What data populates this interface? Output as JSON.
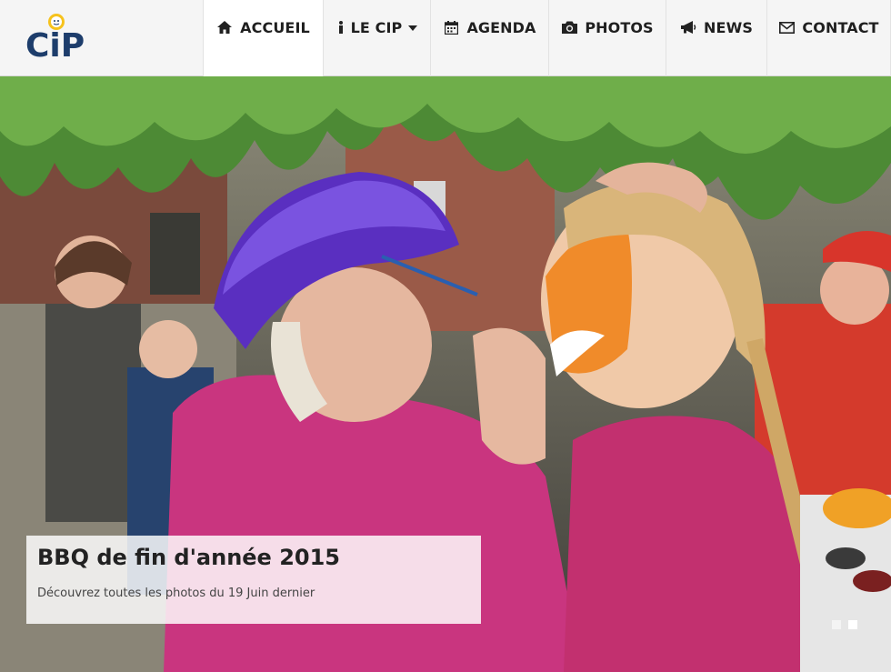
{
  "brand": {
    "logo_text": "CiP"
  },
  "nav": {
    "items": [
      {
        "label": "ACCUEIL",
        "icon": "home-icon"
      },
      {
        "label": "LE CIP",
        "icon": "info-icon"
      },
      {
        "label": "AGENDA",
        "icon": "calendar-icon"
      },
      {
        "label": "PHOTOS",
        "icon": "camera-icon"
      },
      {
        "label": "NEWS",
        "icon": "bullhorn-icon"
      },
      {
        "label": "CONTACT",
        "icon": "envelope-icon"
      }
    ],
    "active": "ACCUEIL"
  },
  "slider": {
    "caption_title": "BBQ de fin d'année 2015",
    "caption_text": "Découvrez toutes les photos du 19 Juin dernier",
    "slides": 2,
    "current_slide": 2
  }
}
